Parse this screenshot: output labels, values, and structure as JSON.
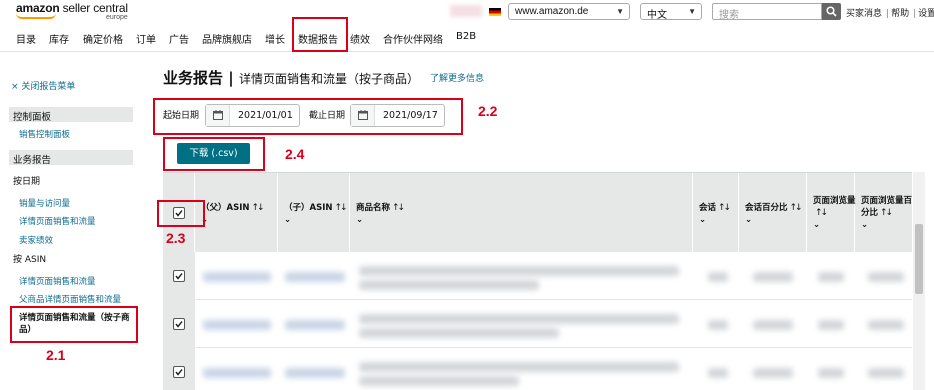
{
  "header": {
    "logo_brand": "amazon",
    "logo_product": "seller central",
    "logo_region": "europe",
    "marketplace": "www.amazon.de",
    "language": "中文",
    "search_placeholder": "搜索",
    "links": [
      "买家消息",
      "帮助",
      "设置"
    ]
  },
  "nav": {
    "items": [
      "目录",
      "库存",
      "确定价格",
      "订单",
      "广告",
      "品牌旗舰店",
      "增长",
      "数据报告",
      "绩效",
      "合作伙伴网络",
      "B2B"
    ]
  },
  "sidebar": {
    "close_label": "× 关闭报告菜单",
    "section1": "控制面板",
    "section1_link": "销售控制面板",
    "section2": "业务报告",
    "by_date": "按日期",
    "date_links": [
      "销量与访问量",
      "详情页面销售和流量",
      "卖家绩效"
    ],
    "by_asin": "按 ASIN",
    "asin_links": [
      "详情页面销售和流量",
      "父商品详情页面销售和流量"
    ],
    "active_item": "详情页面销售和流量（按子商品）"
  },
  "page": {
    "title": "业务报告 |",
    "subtitle": "详情页面销售和流量（按子商品）",
    "learn_more": "了解更多信息",
    "start_label": "起始日期",
    "start_date": "2021/01/01",
    "end_label": "截止日期",
    "end_date": "2021/09/17",
    "download_label": "下载 (.csv)"
  },
  "annotations": [
    "2.1",
    "2.2",
    "2.3",
    "2.4"
  ],
  "table": {
    "columns": [
      "（父）ASIN",
      "（子）ASIN",
      "商品名称",
      "会话",
      "会话百分比",
      "页面浏览量",
      "页面浏览量百分比"
    ]
  },
  "colors": {
    "accent": "#007185",
    "link": "#0e6c8f",
    "annotation": "#d9001b",
    "header_bg": "#e6e8e8"
  }
}
